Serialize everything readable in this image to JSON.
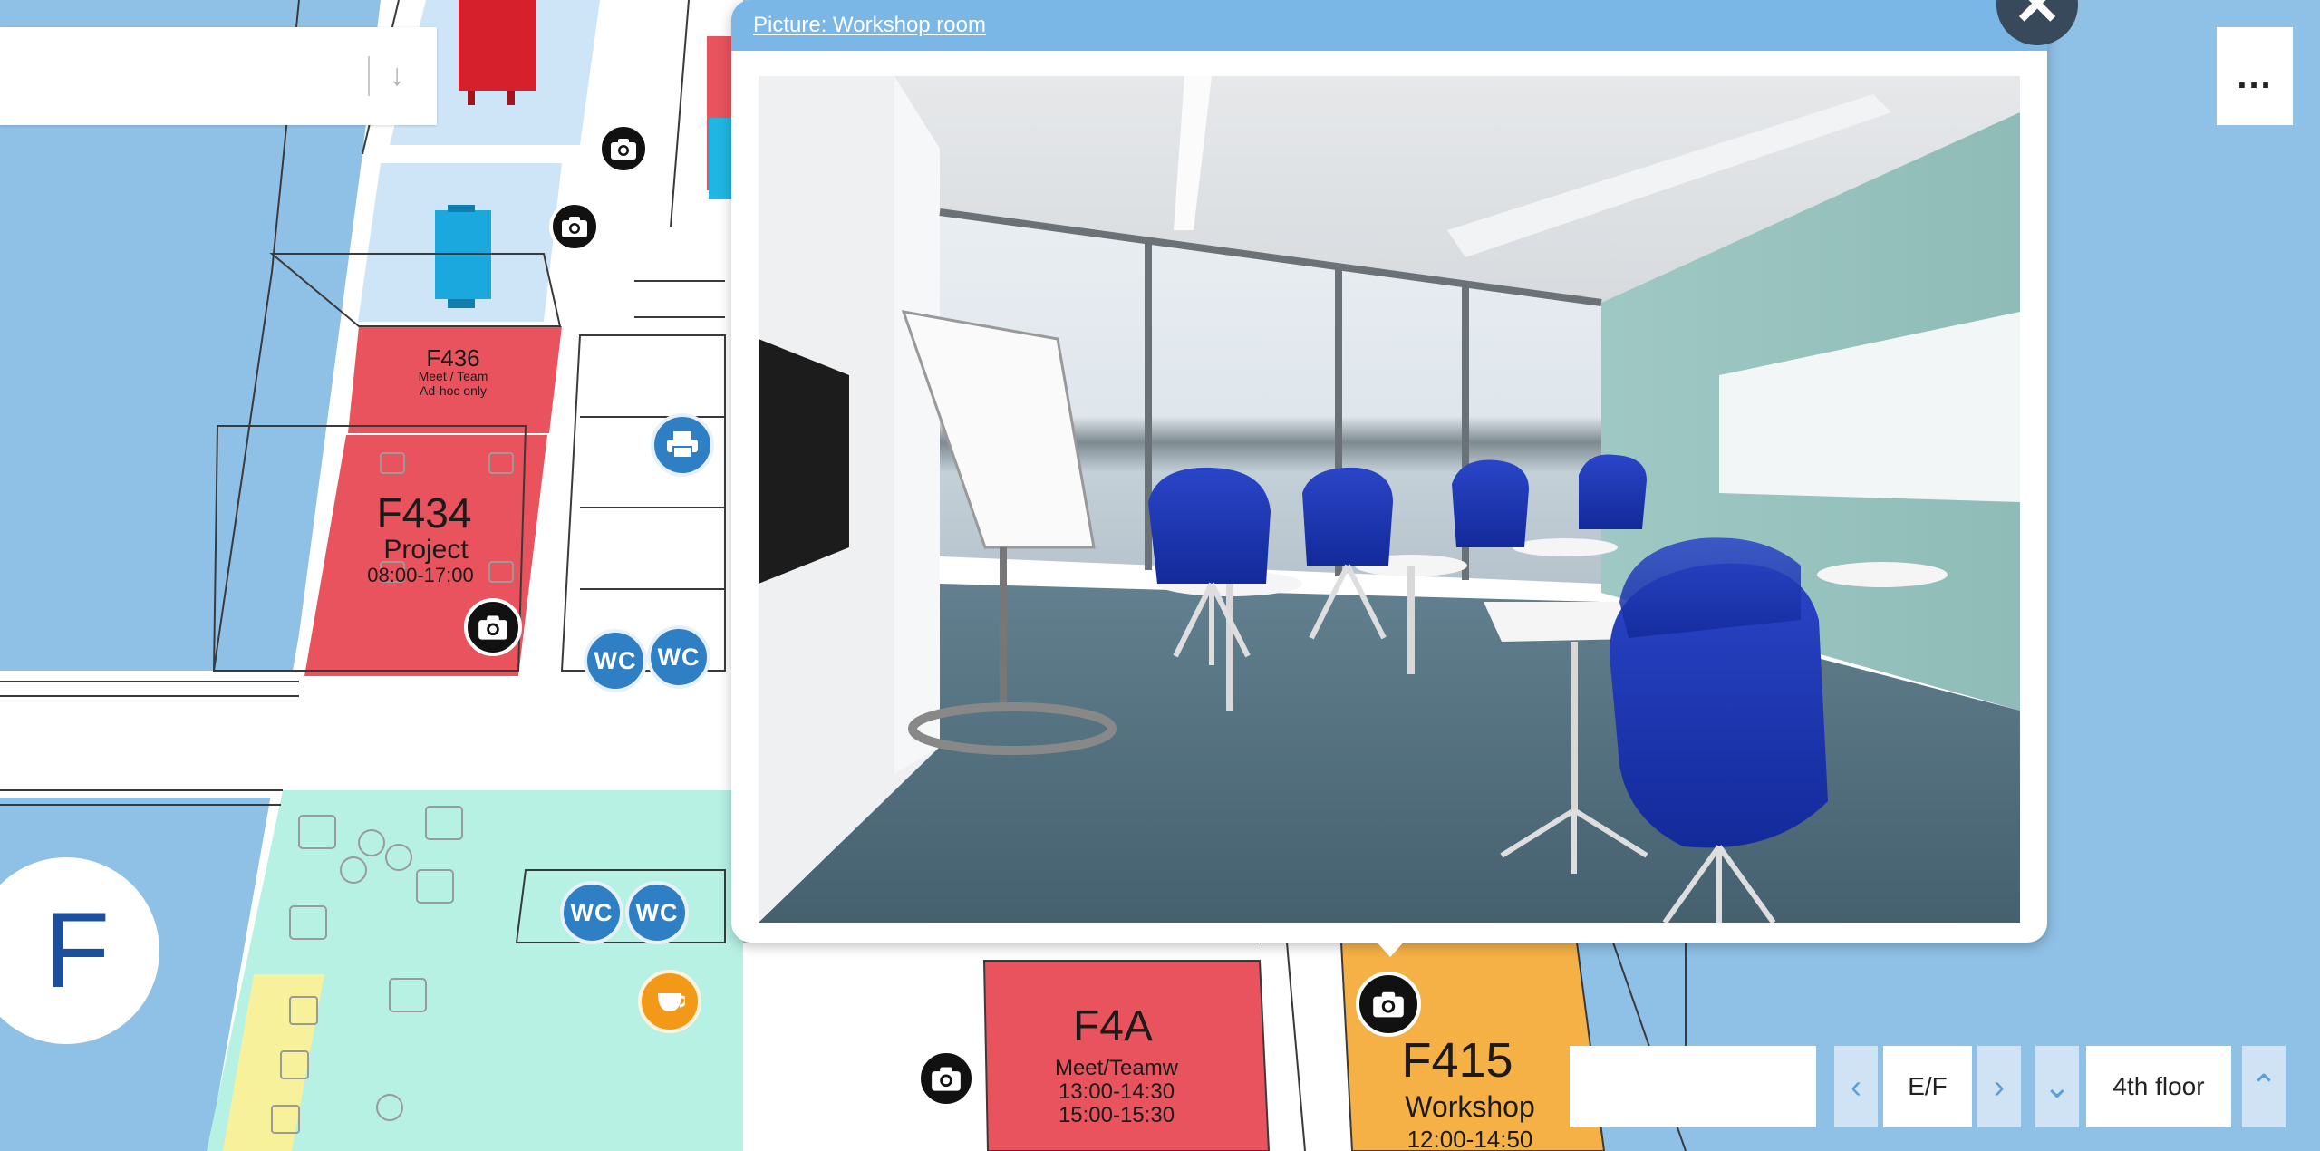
{
  "search": {
    "placeholder": "",
    "value": ""
  },
  "menu": {
    "label": "..."
  },
  "building": {
    "letter": "F"
  },
  "popup": {
    "title": "Picture: Workshop room",
    "close_label": "✕"
  },
  "rooms": {
    "f436": {
      "name": "F436",
      "line1": "Meet / Team",
      "line2": "Ad-hoc only"
    },
    "f434": {
      "name": "F434",
      "line1": "Project",
      "line2": "08:00-17:00"
    },
    "f4a": {
      "name": "F4A",
      "line1": "Meet/Teamw",
      "line2": "13:00-14:30",
      "line3": "15:00-15:30"
    },
    "f415": {
      "name": "F415",
      "line1": "Workshop",
      "line2": "12:00-14:50"
    }
  },
  "markers": {
    "wc_label": "WC"
  },
  "floor_nav": {
    "filter_value": "",
    "prev_building_label": "‹",
    "building_label": "E/F",
    "next_building_label": "›",
    "floor_down_label": "⌄",
    "floor_label": "4th floor",
    "floor_up_label": "⌃"
  },
  "colors": {
    "background": "#8fc0e6",
    "meeting_room": "#e8535e",
    "workshop_room": "#f6b146",
    "lounge": "#b6f1e4",
    "storage": "#f7f19c",
    "popup_header": "#7ab6e6",
    "marker_blue": "#2f7fc4"
  }
}
